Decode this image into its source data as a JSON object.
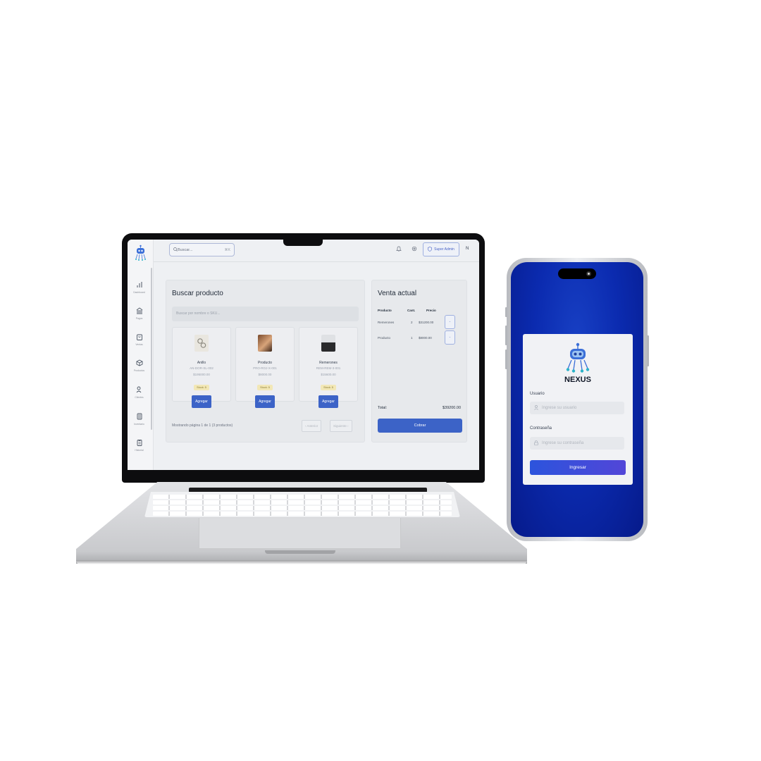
{
  "laptop_app": {
    "search": {
      "placeholder": "Buscar...",
      "shortcut": "⌘K"
    },
    "topbar": {
      "role_badge": "Super Admin",
      "avatar_initial": "N"
    },
    "sidebar": {
      "items": [
        {
          "label": "Dashboard",
          "icon": "bar-chart-icon"
        },
        {
          "label": "Pagos",
          "icon": "bank-icon"
        },
        {
          "label": "Ventas",
          "icon": "shopping-bag-icon"
        },
        {
          "label": "Productos",
          "icon": "package-icon"
        },
        {
          "label": "Clientes",
          "icon": "users-icon"
        },
        {
          "label": "Inventario",
          "icon": "inventory-icon"
        },
        {
          "label": "Historial",
          "icon": "clipboard-icon"
        }
      ]
    },
    "product_panel": {
      "title": "Buscar producto",
      "search_placeholder": "Buscar por nombre o SKU...",
      "products": [
        {
          "name": "Anillo",
          "sku": "AN-DOR-SL-002",
          "price": "$195000.00",
          "stock": "Stock: 5",
          "add_label": "Agregar"
        },
        {
          "name": "Producto",
          "sku": "PRO-ROJ-X-001",
          "price": "$8000.00",
          "stock": "Stock: 5",
          "add_label": "Agregar"
        },
        {
          "name": "Remerones",
          "sku": "REM-REM-3-001",
          "price": "$15600.00",
          "stock": "Stock: 5",
          "add_label": "Agregar"
        }
      ],
      "pagination_text": "Mostrando página 1 de 1 (3 productos)",
      "prev_label": "‹ Anterior",
      "next_label": "Siguiente ›"
    },
    "sale_panel": {
      "title": "Venta actual",
      "headers": {
        "product": "Producto",
        "qty": "Cant.",
        "price": "Precio"
      },
      "items": [
        {
          "product": "Remerones",
          "qty": "2",
          "price": "$31200.00",
          "remove": "-"
        },
        {
          "product": "Producto",
          "qty": "1",
          "price": "$8000.00",
          "remove": "-"
        }
      ],
      "total_label": "Total:",
      "total_value": "$39200.00",
      "charge_label": "Cobrar"
    }
  },
  "phone_app": {
    "brand": "NEXUS",
    "username_label": "Usuario",
    "username_placeholder": "Ingrese su usuario",
    "password_label": "Contraseña",
    "password_placeholder": "Ingrese su contraseña",
    "login_label": "Ingresar"
  },
  "colors": {
    "accent": "#3c63c7",
    "phone_background": "#0b2bb0",
    "stock_badge": "#f2e7b6"
  }
}
